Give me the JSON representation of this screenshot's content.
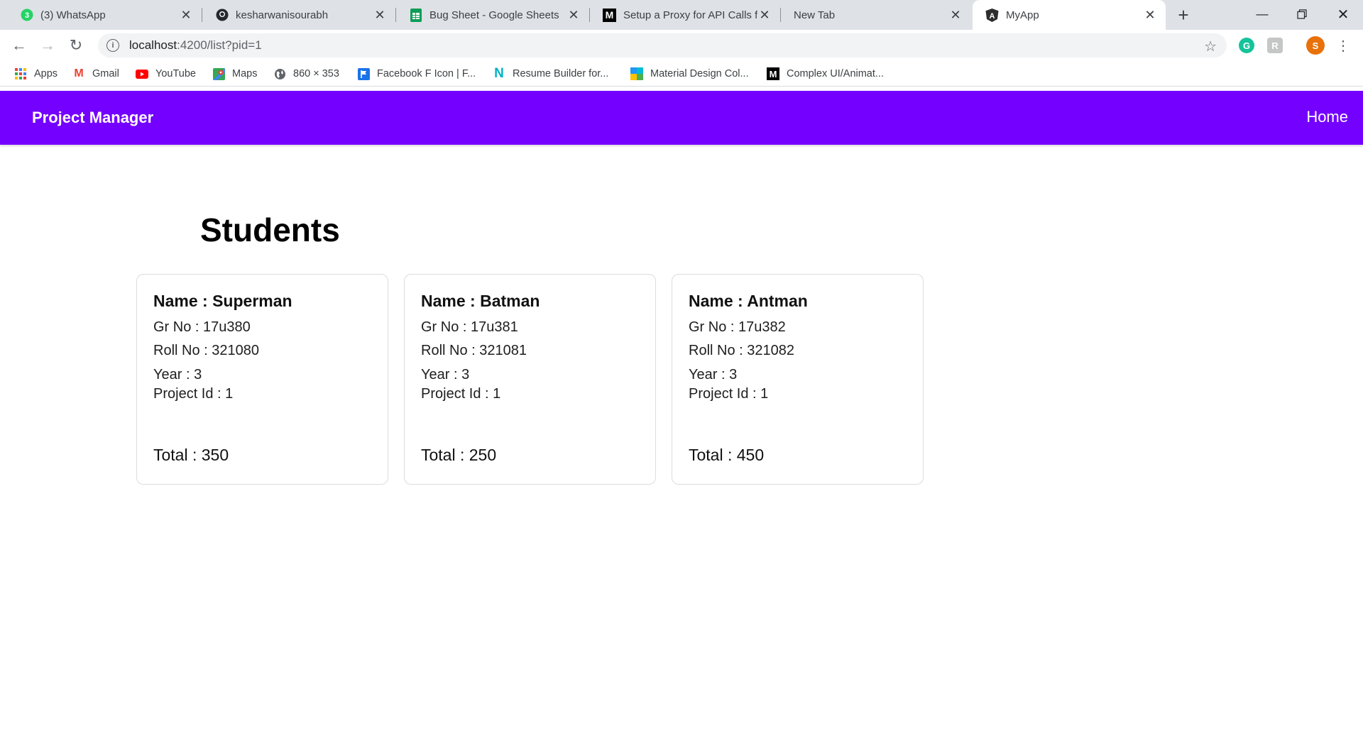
{
  "browser": {
    "tabs": [
      {
        "title": "(3) WhatsApp",
        "icon": "whatsapp-icon",
        "badge": "3"
      },
      {
        "title": "kesharwanisourabh",
        "icon": "github-icon"
      },
      {
        "title": "Bug Sheet - Google Sheets",
        "icon": "sheets-icon"
      },
      {
        "title": "Setup a Proxy for API Calls fo",
        "icon": "medium-icon",
        "icon_letter": "M"
      },
      {
        "title": "New Tab",
        "icon": ""
      },
      {
        "title": "MyApp",
        "icon": "angular-icon",
        "icon_letter": "A"
      }
    ],
    "url_host": "localhost",
    "url_rest": ":4200/list?pid=1",
    "profile_initial": "S",
    "bookmarks": [
      {
        "label": "Apps",
        "icon": "apps-grid-icon"
      },
      {
        "label": "Gmail",
        "icon": "gmail-icon",
        "letter": "M"
      },
      {
        "label": "YouTube",
        "icon": "youtube-icon"
      },
      {
        "label": "Maps",
        "icon": "maps-icon"
      },
      {
        "label": "860 × 353",
        "icon": "globe-icon"
      },
      {
        "label": "Facebook F Icon | F...",
        "icon": "flag-icon"
      },
      {
        "label": "Resume Builder for...",
        "icon": "n-logo-icon",
        "letter": "N"
      },
      {
        "label": "Material Design Col...",
        "icon": "palette-icon"
      },
      {
        "label": "Complex UI/Animat...",
        "icon": "medium-icon",
        "letter": "M"
      }
    ]
  },
  "app": {
    "brand": "Project Manager",
    "nav_home": "Home",
    "heading": "Students",
    "colors": {
      "nav_bg": "#7400ff"
    }
  },
  "students": [
    {
      "name": "Name : Superman",
      "gr": "Gr No : 17u380",
      "roll": "Roll No : 321080",
      "year": "Year : 3",
      "project": "Project Id : 1",
      "total": "Total : 350"
    },
    {
      "name": "Name : Batman",
      "gr": "Gr No : 17u381",
      "roll": "Roll No : 321081",
      "year": "Year : 3",
      "project": "Project Id : 1",
      "total": "Total : 250"
    },
    {
      "name": "Name : Antman",
      "gr": "Gr No : 17u382",
      "roll": "Roll No : 321082",
      "year": "Year : 3",
      "project": "Project Id : 1",
      "total": "Total : 450"
    }
  ]
}
